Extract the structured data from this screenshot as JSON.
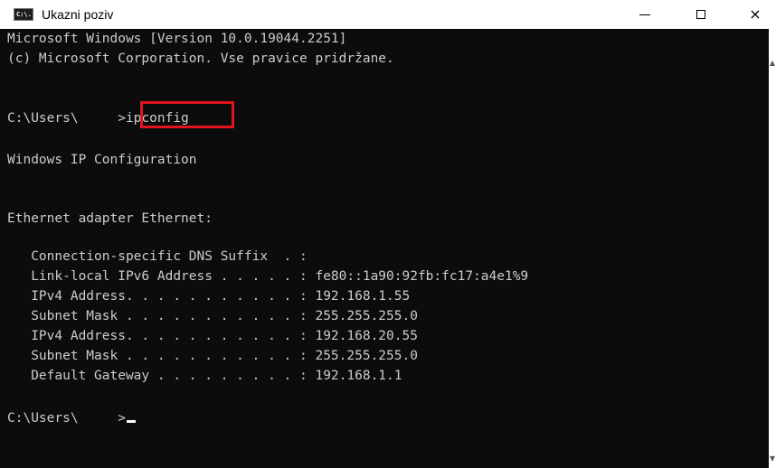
{
  "window": {
    "title": "Ukazni poziv",
    "icon": "cmd-icon",
    "icon_text": "C:\\."
  },
  "controls": {
    "minimize": "minimize-icon",
    "maximize": "maximize-icon",
    "close": "close-icon",
    "close_glyph": "×"
  },
  "console": {
    "lines": [
      "Microsoft Windows [Version 10.0.19044.2251]",
      "(c) Microsoft Corporation. Vse pravice pridržane.",
      "",
      "C:\\Users\\     >ipconfig",
      "",
      "Windows IP Configuration",
      "",
      "",
      "Ethernet adapter Ethernet:",
      "",
      "   Connection-specific DNS Suffix  . :",
      "   Link-local IPv6 Address . . . . . : fe80::1a90:92fb:fc17:a4e1%9",
      "   IPv4 Address. . . . . . . . . . . : 192.168.1.55",
      "   Subnet Mask . . . . . . . . . . . : 255.255.255.0",
      "   IPv4 Address. . . . . . . . . . . : 192.168.20.55",
      "   Subnet Mask . . . . . . . . . . . : 255.255.255.0",
      "   Default Gateway . . . . . . . . . : 192.168.1.1",
      "",
      "C:\\Users\\     >"
    ],
    "highlighted_command": "ipconfig",
    "colors": {
      "background": "#0c0c0c",
      "text": "#cccccc",
      "highlight_border": "#e2141d"
    }
  }
}
